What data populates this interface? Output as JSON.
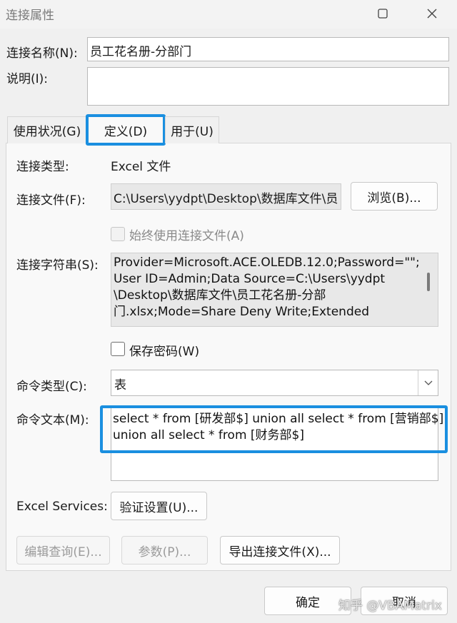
{
  "window": {
    "title": "连接属性"
  },
  "fields": {
    "name_label": "连接名称(N):",
    "name_value": "员工花名册-分部门",
    "desc_label": "说明(I):",
    "desc_value": ""
  },
  "tabs": [
    {
      "label": "使用状况(G)"
    },
    {
      "label": "定义(D)"
    },
    {
      "label": "用于(U)"
    }
  ],
  "definition": {
    "conn_type_label": "连接类型:",
    "conn_type_value": "Excel 文件",
    "conn_file_label": "连接文件(F):",
    "conn_file_value": "C:\\Users\\yydpt\\Desktop\\数据库文件\\员",
    "browse_button": "浏览(B)...",
    "always_use_file_label": "始终使用连接文件(A)",
    "conn_string_label": "连接字符串(S):",
    "conn_string_lines": [
      "Provider=Microsoft.ACE.OLEDB.12.0;Password=\"\";",
      "User ID=Admin;Data Source=C:\\Users\\yydpt",
      "\\Desktop\\数据库文件\\员工花名册-分部",
      "门.xlsx;Mode=Share Deny Write;Extended"
    ],
    "save_password_label": "保存密码(W)",
    "cmd_type_label": "命令类型(C):",
    "cmd_type_value": "表",
    "cmd_text_label": "命令文本(M):",
    "cmd_text_lines": [
      "select * from [研发部$] union all select * from [营销部$]",
      "union all select * from [财务部$]"
    ],
    "excel_services_label": "Excel Services:",
    "auth_settings_button": "验证设置(U)...",
    "edit_query_button": "编辑查询(E)...",
    "params_button": "参数(P)...",
    "export_button": "导出连接文件(X)..."
  },
  "footer": {
    "ok_button": "确定",
    "cancel_button": "取消"
  },
  "watermark": "知乎 @VBAMatrix",
  "colors": {
    "highlight": "#1a8fe0",
    "background": "#f0f0f0"
  }
}
